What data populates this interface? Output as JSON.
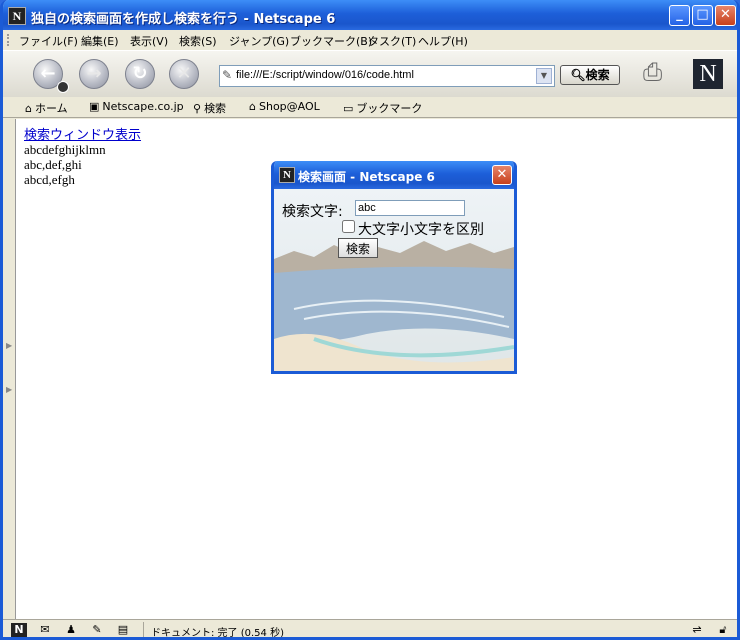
{
  "window": {
    "title": "独自の検索画面を作成し検索を行う - Netscape 6",
    "app_icon": "N"
  },
  "title_buttons": {
    "minimize": "_",
    "maximize": "□",
    "close": "✕"
  },
  "menu": [
    "ファイル(F)",
    "編集(E)",
    "表示(V)",
    "検索(S)",
    "ジャンプ(G)",
    "ブックマーク(B)",
    "タスク(T)",
    "ヘルプ(H)"
  ],
  "navigation": {
    "url": "file:///E:/script/window/016/code.html",
    "search_label": "検索",
    "logo": "N",
    "back_glyph": "←",
    "forward_glyph": "→",
    "reload_glyph": "↻",
    "stop_glyph": "✕"
  },
  "bookmarks": [
    "ホーム",
    "Netscape.co.jp",
    "検索",
    "Shop@AOL",
    "ブックマーク"
  ],
  "page": {
    "link": "検索ウィンドウ表示",
    "lines": [
      "abcdefghijklmn",
      "abc,def,ghi",
      "abcd,efgh"
    ]
  },
  "popup": {
    "title": "検索画面 - Netscape 6",
    "app_icon": "N",
    "search_label": "検索文字:",
    "search_value": "abc",
    "case_label": "大文字小文字を区別",
    "submit_label": "検索"
  },
  "status": {
    "text": "ドキュメント: 完了 (0.54 秒)"
  }
}
